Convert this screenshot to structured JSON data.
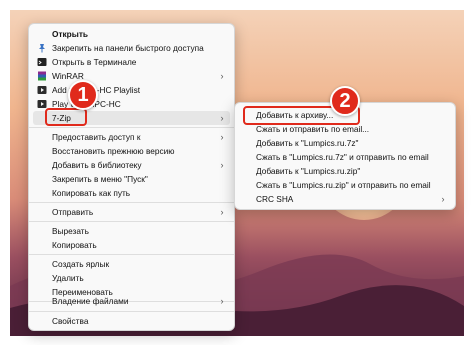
{
  "main_menu": {
    "items": [
      {
        "label": "Открыть",
        "icon": "open-icon",
        "bold": true,
        "chevron": false
      },
      {
        "label": "Закрепить на панели быстрого доступа",
        "icon": "pin-icon",
        "chevron": false
      },
      {
        "label": "Открыть в Терминале",
        "icon": "terminal-icon",
        "chevron": false
      },
      {
        "label": "WinRAR",
        "icon": "winrar-icon",
        "chevron": true
      },
      {
        "label": "Add to MPC-HC Playlist",
        "icon": "mpc-icon",
        "chevron": false
      },
      {
        "label": "Play with MPC-HC",
        "icon": "mpc-icon",
        "chevron": false
      },
      {
        "label": "7-Zip",
        "icon": "blank",
        "chevron": true
      },
      {
        "label": "Предоставить доступ к",
        "icon": "blank",
        "chevron": true
      },
      {
        "label": "Восстановить прежнюю версию",
        "icon": "blank",
        "chevron": false
      },
      {
        "label": "Добавить в библиотеку",
        "icon": "blank",
        "chevron": true
      },
      {
        "label": "Закрепить в меню \"Пуск\"",
        "icon": "blank",
        "chevron": false
      },
      {
        "label": "Копировать как путь",
        "icon": "blank",
        "chevron": false
      },
      {
        "label": "Отправить",
        "icon": "blank",
        "chevron": true
      },
      {
        "label": "Вырезать",
        "icon": "blank",
        "chevron": false
      },
      {
        "label": "Копировать",
        "icon": "blank",
        "chevron": false
      },
      {
        "label": "Создать ярлык",
        "icon": "blank",
        "chevron": false
      },
      {
        "label": "Удалить",
        "icon": "blank",
        "chevron": false
      },
      {
        "label": "Переименовать",
        "icon": "blank",
        "chevron": false
      },
      {
        "label": "Владение файлами",
        "icon": "blank",
        "chevron": true
      },
      {
        "label": "Свойства",
        "icon": "blank",
        "chevron": false
      }
    ]
  },
  "sub_menu": {
    "items": [
      {
        "label": "Добавить к архиву...",
        "chevron": false
      },
      {
        "label": "Сжать и отправить по email...",
        "chevron": false
      },
      {
        "label": "Добавить к \"Lumpics.ru.7z\"",
        "chevron": false
      },
      {
        "label": "Сжать в \"Lumpics.ru.7z\" и отправить по email",
        "chevron": false
      },
      {
        "label": "Добавить к \"Lumpics.ru.zip\"",
        "chevron": false
      },
      {
        "label": "Сжать в \"Lumpics.ru.zip\" и отправить по email",
        "chevron": false
      },
      {
        "label": "CRC SHA",
        "chevron": true
      }
    ]
  },
  "badges": {
    "step1": "1",
    "step2": "2"
  },
  "colors": {
    "accent": "#e02a1c",
    "menu_bg": "#f9f9f9"
  }
}
